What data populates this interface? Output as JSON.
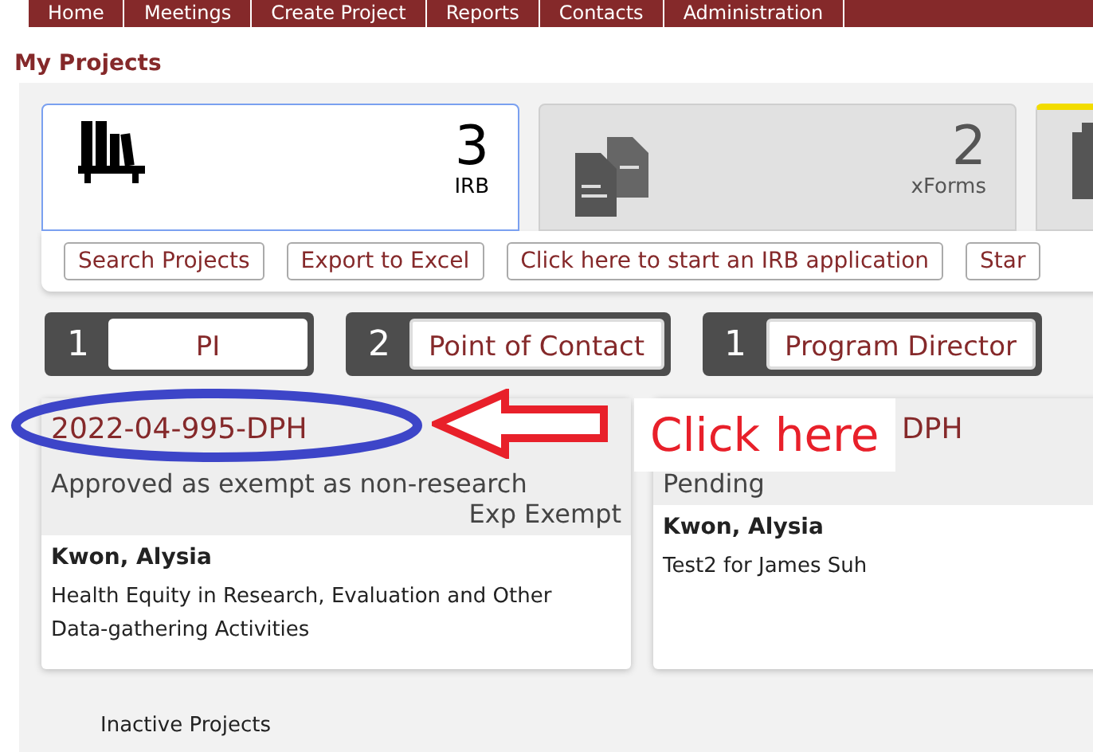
{
  "nav": [
    "Home",
    "Meetings",
    "Create Project",
    "Reports",
    "Contacts",
    "Administration"
  ],
  "page_title": "My Projects",
  "tiles": [
    {
      "kind": "irb",
      "count": "3",
      "label": "IRB",
      "selected": true
    },
    {
      "kind": "xforms",
      "count": "2",
      "label": "xForms",
      "selected": false
    },
    {
      "kind": "clipboard",
      "selected": false
    }
  ],
  "actions": [
    "Search Projects",
    "Export to Excel",
    "Click here to start an IRB application",
    "Star"
  ],
  "roles": [
    {
      "count": "1",
      "label": "PI",
      "selected": true
    },
    {
      "count": "2",
      "label": "Point of Contact",
      "selected": false
    },
    {
      "count": "1",
      "label": "Program Director",
      "selected": false
    }
  ],
  "projects": [
    {
      "highlighted": true,
      "id": "2022-04-995-DPH",
      "status": "Approved as exempt as non-research",
      "type": "Exp Exempt",
      "person": "Kwon, Alysia",
      "title": "Health Equity in Research, Evaluation and Other Data-gathering Activities"
    },
    {
      "highlighted": false,
      "id": "DPH",
      "status": "Pending",
      "person": "Kwon, Alysia",
      "title": "Test2 for James Suh"
    }
  ],
  "annotation": {
    "text": "Click here"
  },
  "footer_link": "Inactive Projects"
}
